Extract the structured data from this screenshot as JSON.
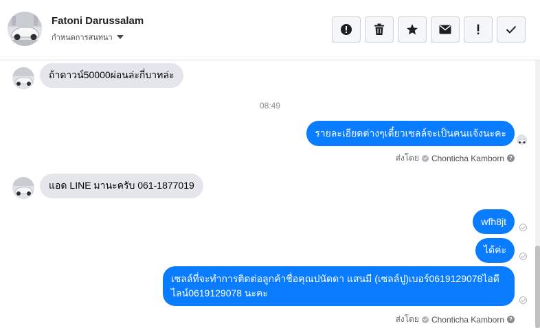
{
  "header": {
    "name": "Fatoni Darussalam",
    "subtitle": "กำหนดการสนทนา",
    "toolbar": [
      {
        "icon": "alert-circle-icon",
        "name": "report-button"
      },
      {
        "icon": "trash-icon",
        "name": "delete-button"
      },
      {
        "icon": "star-icon",
        "name": "star-button"
      },
      {
        "icon": "envelope-icon",
        "name": "mark-unread-button"
      },
      {
        "icon": "exclamation-icon",
        "name": "spam-button"
      },
      {
        "icon": "checkmark-icon",
        "name": "done-button"
      }
    ]
  },
  "colors": {
    "outgoing": "#0a7cff",
    "incoming": "#e4e6eb"
  },
  "messages": {
    "m1": "ถ้าดาวน์50000ผ่อนล่ะกี่บาทล่ะ",
    "time": "08:49",
    "m2": "รายละเอียดต่างๆเดี๋ยวเซลล์จะเป็นคนแจ้งนะคะ",
    "m3": "แอด LINE มานะครับ 061-1877019",
    "m4": "wfh8jt",
    "m5": "ได้ค่ะ",
    "m6": "เซลล์ที่จะทำการติดต่อลูกค้าชื่อคุณปนัดดา แสนมี (เซลล์ปู)เบอร์0619129078ไอดีไลน์0619129078 นะคะ"
  },
  "sent_by": {
    "label": "ส่งโดย",
    "agent": "Chonticha Kamborn"
  }
}
